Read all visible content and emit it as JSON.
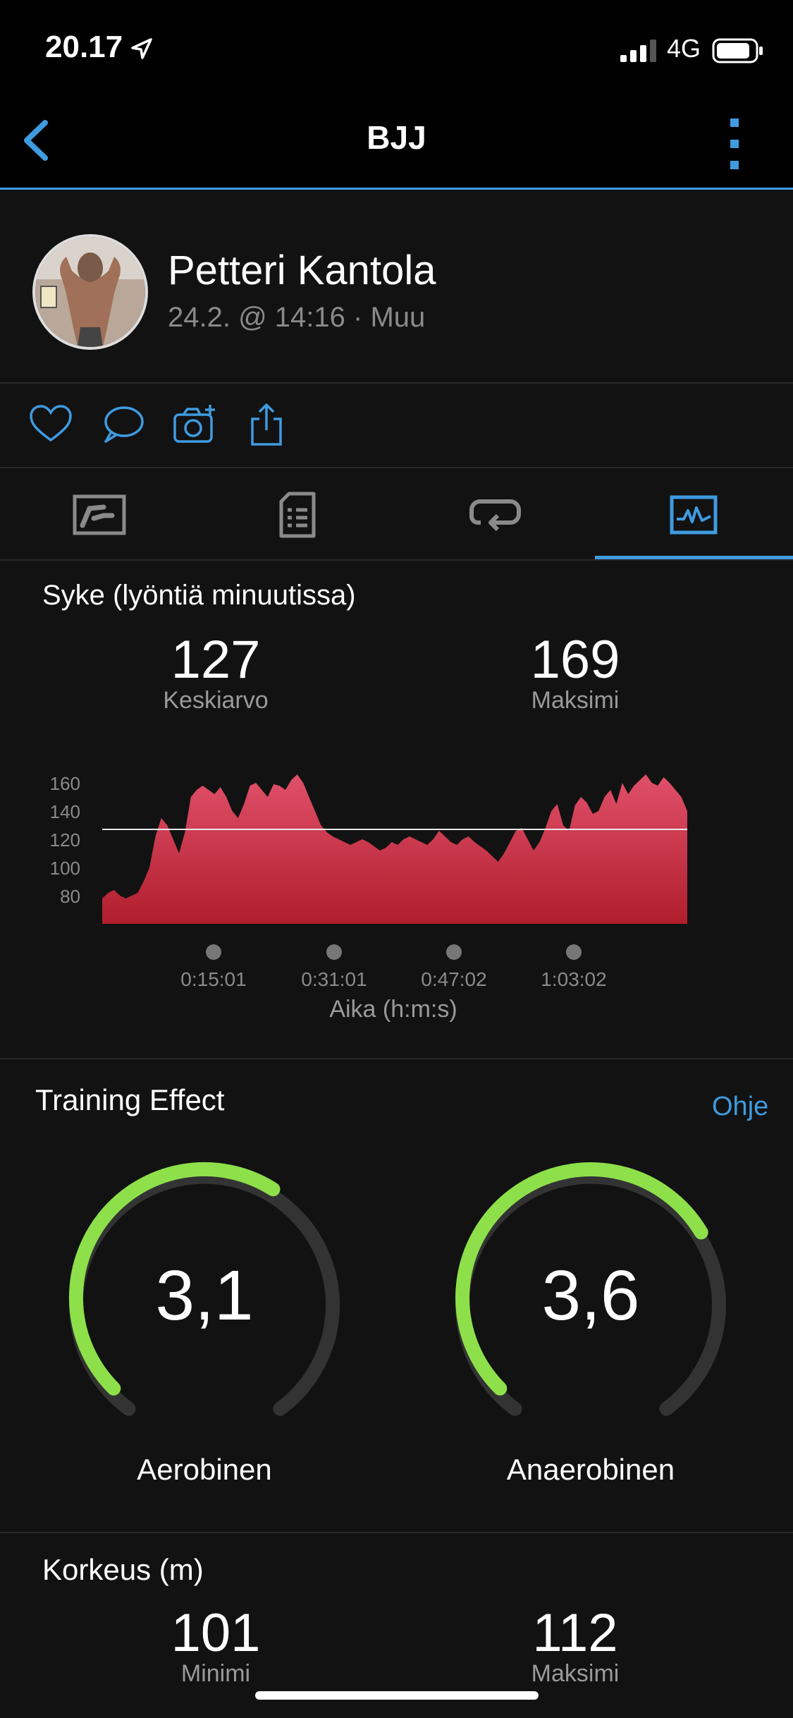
{
  "status": {
    "time": "20.17",
    "network": "4G"
  },
  "nav": {
    "title": "BJJ"
  },
  "profile": {
    "name": "Petteri Kantola",
    "meta": "24.2. @ 14:16 · Muu"
  },
  "heart_rate": {
    "title": "Syke (lyöntiä minuutissa)",
    "avg_value": "127",
    "avg_label": "Keskiarvo",
    "max_value": "169",
    "max_label": "Maksimi",
    "x_axis_title": "Aika (h:m:s)"
  },
  "training_effect": {
    "title": "Training Effect",
    "help": "Ohje",
    "aerobic_value": "3,1",
    "aerobic_label": "Aerobinen",
    "anaerobic_value": "3,6",
    "anaerobic_label": "Anaerobinen"
  },
  "altitude": {
    "title": "Korkeus (m)",
    "min_value": "101",
    "min_label": "Minimi",
    "max_value": "112",
    "max_label": "Maksimi"
  },
  "colors": {
    "accent": "#3f9be0",
    "hr_fill": "#d0334a",
    "gauge_green": "#8ee04a",
    "gauge_track": "#333333"
  },
  "chart_data": {
    "type": "area",
    "ylabel": "",
    "xlabel": "Aika (h:m:s)",
    "ylim": [
      60,
      170
    ],
    "yticks": [
      160,
      140,
      120,
      100,
      80
    ],
    "xticks": [
      "0:15:01",
      "0:31:01",
      "0:47:02",
      "1:03:02"
    ],
    "average_line": 127,
    "series": [
      {
        "values": [
          78,
          82,
          84,
          80,
          78,
          80,
          82,
          90,
          100,
          122,
          135,
          130,
          120,
          110,
          125,
          150,
          155,
          158,
          155,
          152,
          157,
          150,
          140,
          135,
          145,
          158,
          160,
          155,
          150,
          159,
          158,
          155,
          162,
          166,
          160,
          150,
          140,
          130,
          125,
          122,
          120,
          118,
          116,
          118,
          120,
          118,
          115,
          112,
          114,
          118,
          116,
          120,
          122,
          120,
          118,
          116,
          120,
          126,
          122,
          118,
          116,
          120,
          122,
          118,
          115,
          112,
          108,
          104,
          110,
          118,
          126,
          128,
          120,
          112,
          118,
          128,
          140,
          145,
          130,
          126,
          144,
          150,
          146,
          138,
          140,
          150,
          155,
          145,
          160,
          152,
          158,
          162,
          166,
          160,
          158,
          164,
          160,
          155,
          150,
          140
        ]
      }
    ]
  }
}
